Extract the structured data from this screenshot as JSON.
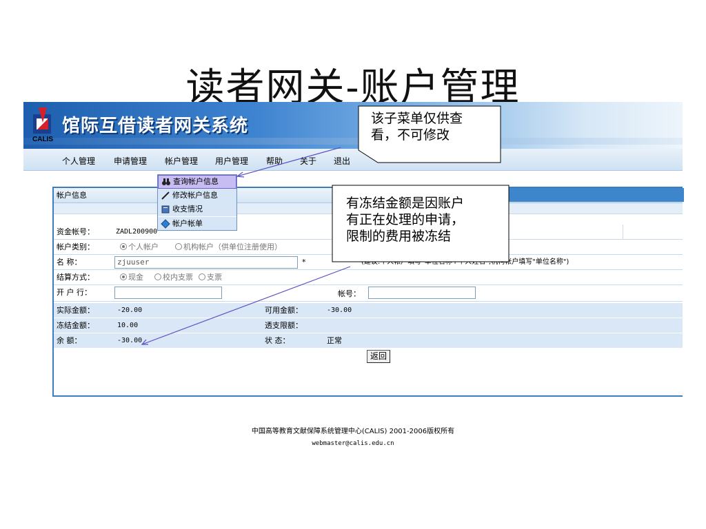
{
  "slide": {
    "title": "读者网关-账户管理"
  },
  "banner": {
    "logo_text": "CALIS",
    "system_name": "馆际互借读者网关系统"
  },
  "nav": [
    {
      "label": "个人管理"
    },
    {
      "label": "申请管理"
    },
    {
      "label": "帐户管理"
    },
    {
      "label": "用户管理"
    },
    {
      "label": "帮助"
    },
    {
      "label": "关于"
    },
    {
      "label": "退出"
    }
  ],
  "dropdown": [
    {
      "label": "查询帐户信息",
      "icon": "binoculars-icon"
    },
    {
      "label": "修改帐户信息",
      "icon": "pen-icon"
    },
    {
      "label": "收支情况",
      "icon": "book-icon"
    },
    {
      "label": "帐户帐单",
      "icon": "bill-icon"
    }
  ],
  "panel": {
    "header": "帐户信息",
    "account_no_label": "资金帐号：",
    "account_no": "ZADL200900",
    "account_type_label": "帐户类别：",
    "account_type_personal": "个人帐户",
    "account_type_org": "机构帐户（供单位注册使用）",
    "name_label": "名 称：",
    "name_value": "zjuuser",
    "required_mark": "*",
    "name_hint": "(建议:个人帐户填写\"单位名称+个人姓名\";机构帐户填写\"单位名称\")",
    "settle_label": "结算方式：",
    "settle_cash": "现金",
    "settle_cheque_internal": "校内支票",
    "settle_cheque": "支票",
    "bank_label": "开 户 行：",
    "bank_value": "",
    "bank_account_label": "帐号：",
    "bank_account_value": "",
    "actual_label": "实际金额：",
    "actual_value": "-20.00",
    "available_label": "可用金额：",
    "available_value": "-30.00",
    "frozen_label": "冻结金额：",
    "frozen_value": "10.00",
    "overdraft_label": "透支限额：",
    "overdraft_value": "",
    "balance_label": "余 额：",
    "balance_value": "-30.00",
    "status_label": "状 态：",
    "status_value": "正常",
    "back_button": "返回"
  },
  "footer": {
    "copyright": "中国高等教育文献保障系统管理中心(CALIS) 2001-2006版权所有",
    "email": "webmaster@calis.edu.cn"
  },
  "callouts": {
    "menu_note_line1": "该子菜单仅供查",
    "menu_note_line2": "看，不可修改",
    "frozen_note_line1": "有冻结金额是因账户",
    "frozen_note_line2": "有正在处理的申请，",
    "frozen_note_line3": "限制的费用被冻结"
  }
}
